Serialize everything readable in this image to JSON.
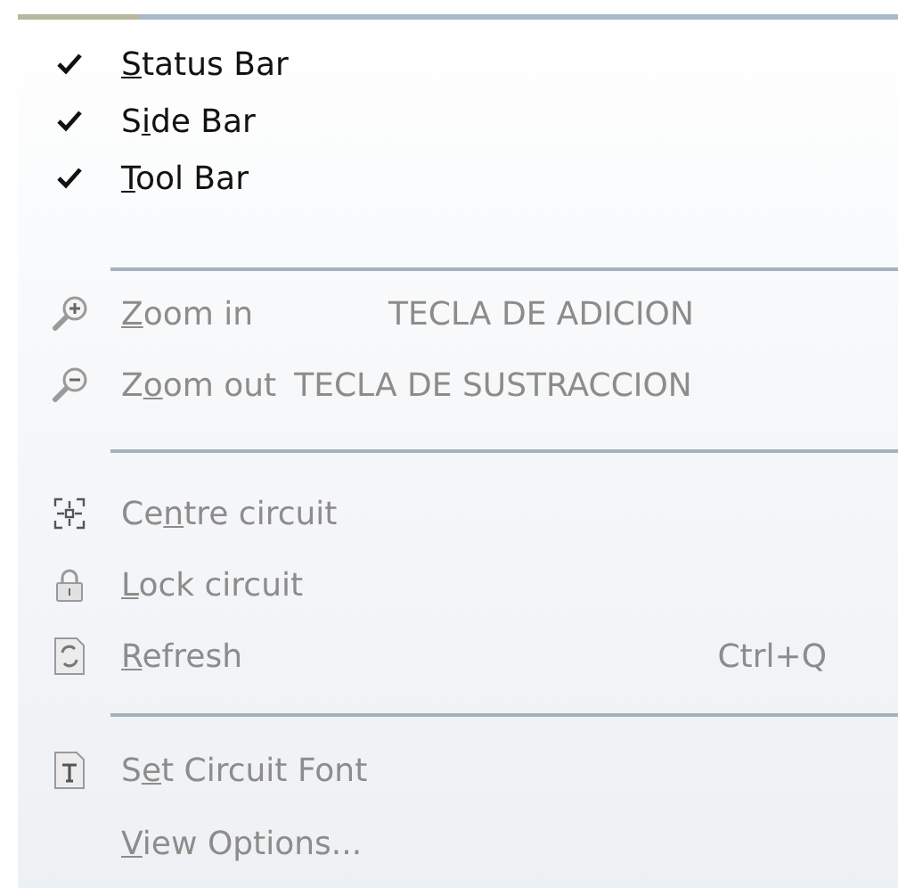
{
  "menu": {
    "items": [
      {
        "kind": "check",
        "checked": true,
        "disabled": false,
        "text": {
          "key": "S",
          "after": "tatus Bar"
        }
      },
      {
        "kind": "check",
        "checked": true,
        "disabled": false,
        "text": {
          "before": "S",
          "key": "i",
          "after": "de Bar"
        }
      },
      {
        "kind": "check",
        "checked": true,
        "disabled": false,
        "text": {
          "key": "T",
          "after": "ool Bar"
        }
      },
      {
        "kind": "separator"
      },
      {
        "kind": "icon",
        "disabled": true,
        "text": {
          "key": "Z",
          "after": "oom in"
        },
        "shortcut": "TECLA DE ADICION"
      },
      {
        "kind": "icon",
        "disabled": true,
        "text": {
          "before": "Z",
          "key": "o",
          "after": "om out"
        },
        "shortcut": "TECLA DE SUSTRACCION"
      },
      {
        "kind": "separator"
      },
      {
        "kind": "icon",
        "disabled": true,
        "text": {
          "before": "Ce",
          "key": "n",
          "after": "tre circuit"
        }
      },
      {
        "kind": "icon",
        "disabled": true,
        "text": {
          "key": "L",
          "after": "ock circuit"
        }
      },
      {
        "kind": "icon",
        "disabled": true,
        "text": {
          "key": "R",
          "after": "efresh"
        },
        "shortcut": "Ctrl+Q"
      },
      {
        "kind": "separator"
      },
      {
        "kind": "icon",
        "disabled": true,
        "text": {
          "before": "S",
          "key": "e",
          "after": "t Circuit Font"
        }
      },
      {
        "kind": "plain",
        "disabled": true,
        "text": {
          "key": "V",
          "after": "iew Options..."
        }
      }
    ]
  }
}
